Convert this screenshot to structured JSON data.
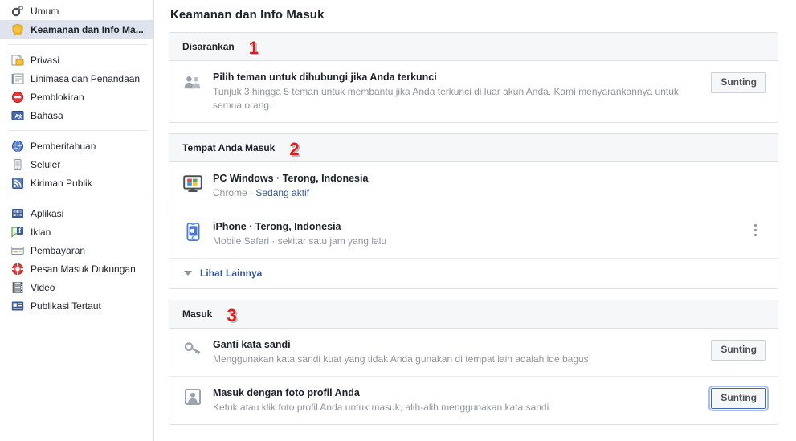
{
  "sidebar": {
    "groups": [
      {
        "items": [
          {
            "label": "Umum",
            "icon": "gears-icon",
            "selected": false
          },
          {
            "label": "Keamanan dan Info Ma...",
            "icon": "shield-icon",
            "selected": true
          }
        ]
      },
      {
        "items": [
          {
            "label": "Privasi",
            "icon": "lock-icon",
            "selected": false
          },
          {
            "label": "Linimasa dan Penandaan",
            "icon": "timeline-icon",
            "selected": false
          },
          {
            "label": "Pemblokiran",
            "icon": "block-icon",
            "selected": false
          },
          {
            "label": "Bahasa",
            "icon": "language-icon",
            "selected": false
          }
        ]
      },
      {
        "items": [
          {
            "label": "Pemberitahuan",
            "icon": "globe-icon",
            "selected": false
          },
          {
            "label": "Seluler",
            "icon": "mobile-icon",
            "selected": false
          },
          {
            "label": "Kiriman Publik",
            "icon": "rss-icon",
            "selected": false
          }
        ]
      },
      {
        "items": [
          {
            "label": "Aplikasi",
            "icon": "apps-icon",
            "selected": false
          },
          {
            "label": "Iklan",
            "icon": "ads-icon",
            "selected": false
          },
          {
            "label": "Pembayaran",
            "icon": "card-icon",
            "selected": false
          },
          {
            "label": "Pesan Masuk Dukungan",
            "icon": "lifebuoy-icon",
            "selected": false
          },
          {
            "label": "Video",
            "icon": "film-icon",
            "selected": false
          },
          {
            "label": "Publikasi Tertaut",
            "icon": "publisher-icon",
            "selected": false
          }
        ]
      }
    ]
  },
  "page": {
    "title": "Keamanan dan Info Masuk"
  },
  "sections": [
    {
      "header": "Disarankan",
      "annotation": "1",
      "rows": [
        {
          "icon": "friends-icon",
          "title": "Pilih teman untuk dihubungi jika Anda terkunci",
          "subtitle": "Tunjuk 3 hingga 5 teman untuk membantu jika Anda terkunci di luar akun Anda. Kami menyarankannya untuk semua orang.",
          "button": "Sunting"
        }
      ]
    },
    {
      "header": "Tempat Anda Masuk",
      "annotation": "2",
      "rows": [
        {
          "icon": "windows-pc-icon",
          "title": "PC Windows · Terong, Indonesia",
          "subtitle_plain": "Chrome · ",
          "subtitle_link": "Sedang aktif"
        },
        {
          "icon": "iphone-icon",
          "title": "iPhone · Terong, Indonesia",
          "subtitle": "Mobile Safari · sekitar satu jam yang lalu",
          "menu": "kebab-menu"
        }
      ],
      "more_label": "Lihat Lainnya"
    },
    {
      "header": "Masuk",
      "annotation": "3",
      "rows": [
        {
          "icon": "key-icon",
          "title": "Ganti kata sandi",
          "subtitle": "Menggunakan kata sandi kuat yang tidak Anda gunakan di tempat lain adalah ide bagus",
          "button": "Sunting"
        },
        {
          "icon": "profile-photo-icon",
          "title": "Masuk dengan foto profil Anda",
          "subtitle": "Ketuk atau klik foto profil Anda untuk masuk, alih-alih menggunakan kata sandi",
          "button": "Sunting",
          "button_focused": true
        }
      ]
    }
  ],
  "colors": {
    "link": "#365899",
    "annotation_red": "#e21b1b",
    "selected_nav_bg": "#dfe3ee",
    "card_header_bg": "#f6f7f9",
    "border": "#dddfe2"
  }
}
